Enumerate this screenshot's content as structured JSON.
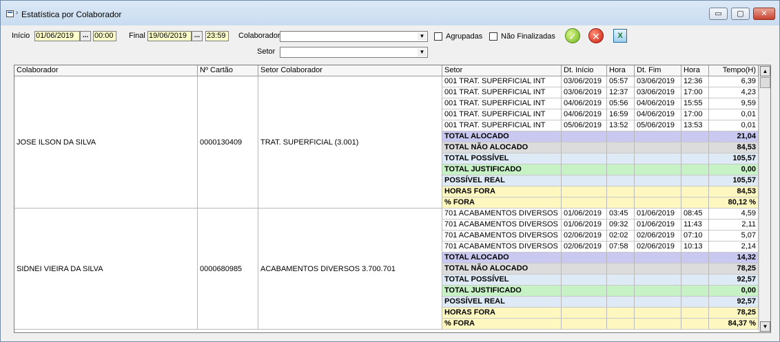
{
  "window": {
    "title": "Estatística por Colaborador",
    "controls": {
      "minimize": "▭",
      "maximize": "▢",
      "close": "✕"
    }
  },
  "filters": {
    "inicio_label": "Início",
    "inicio_date": "01/06/2019",
    "inicio_time": "00:00",
    "final_label": "Final",
    "final_date": "19/06/2019",
    "final_time": "23:59",
    "picker_glyph": "...",
    "colaborador_label": "Colaborador",
    "colaborador_value": "",
    "setor_label": "Setor",
    "setor_value": "",
    "agrupadas_label": "Agrupadas",
    "agrupadas_checked": false,
    "nao_finalizadas_label": "Não Finalizadas",
    "nao_finalizadas_checked": false,
    "dropdown_glyph": "▼",
    "ok_glyph": "✓",
    "cancel_glyph": "✕",
    "excel_glyph": "X"
  },
  "colors": {
    "alocado": "#c8c8f0",
    "nao_alocado": "#dcdcdc",
    "possivel": "#deebf7",
    "justificado": "#c6f2c6",
    "possivel_real": "#deebf7",
    "horas_fora": "#fff7c0",
    "pct_fora": "#fff7c0"
  },
  "grid": {
    "headers": [
      "Colaborador",
      "Nº Cartão",
      "Setor Colaborador",
      "Setor",
      "Dt. Início",
      "Hora",
      "Dt. Fim",
      "Hora",
      "Tempo(H)"
    ],
    "groups": [
      {
        "colaborador": "JOSE ILSON DA SILVA",
        "cartao": "0000130409",
        "setor_colaborador": "TRAT. SUPERFICIAL (3.001)",
        "rows": [
          [
            "001 TRAT. SUPERFICIAL INT",
            "03/06/2019",
            "05:57",
            "03/06/2019",
            "12:36",
            "6,39"
          ],
          [
            "001 TRAT. SUPERFICIAL INT",
            "03/06/2019",
            "12:37",
            "03/06/2019",
            "17:00",
            "4,23"
          ],
          [
            "001 TRAT. SUPERFICIAL INT",
            "04/06/2019",
            "05:56",
            "04/06/2019",
            "15:55",
            "9,59"
          ],
          [
            "001 TRAT. SUPERFICIAL INT",
            "04/06/2019",
            "16:59",
            "04/06/2019",
            "17:00",
            "0,01"
          ],
          [
            "001 TRAT. SUPERFICIAL INT",
            "05/06/2019",
            "13:52",
            "05/06/2019",
            "13:53",
            "0,01"
          ]
        ],
        "totals": [
          {
            "label": "TOTAL ALOCADO",
            "value": "21,04",
            "kind": "alocado"
          },
          {
            "label": "TOTAL NÃO ALOCADO",
            "value": "84,53",
            "kind": "nao_alocado"
          },
          {
            "label": "TOTAL POSSÍVEL",
            "value": "105,57",
            "kind": "possivel"
          },
          {
            "label": "TOTAL JUSTIFICADO",
            "value": "0,00",
            "kind": "justificado"
          },
          {
            "label": "POSSÍVEL REAL",
            "value": "105,57",
            "kind": "possivel_real"
          },
          {
            "label": "HORAS FORA",
            "value": "84,53",
            "kind": "horas_fora"
          },
          {
            "label": "% FORA",
            "value": "80,12 %",
            "kind": "pct_fora"
          }
        ]
      },
      {
        "colaborador": "SIDNEI VIEIRA DA SILVA",
        "cartao": "0000680985",
        "setor_colaborador": "ACABAMENTOS DIVERSOS 3.700.701",
        "rows": [
          [
            "701 ACABAMENTOS DIVERSOS",
            "01/06/2019",
            "03:45",
            "01/06/2019",
            "08:45",
            "4,59"
          ],
          [
            "701 ACABAMENTOS DIVERSOS",
            "01/06/2019",
            "09:32",
            "01/06/2019",
            "11:43",
            "2,11"
          ],
          [
            "701 ACABAMENTOS DIVERSOS",
            "02/06/2019",
            "02:02",
            "02/06/2019",
            "07:10",
            "5,07"
          ],
          [
            "701 ACABAMENTOS DIVERSOS",
            "02/06/2019",
            "07:58",
            "02/06/2019",
            "10:13",
            "2,14"
          ]
        ],
        "totals": [
          {
            "label": "TOTAL ALOCADO",
            "value": "14,32",
            "kind": "alocado"
          },
          {
            "label": "TOTAL NÃO ALOCADO",
            "value": "78,25",
            "kind": "nao_alocado"
          },
          {
            "label": "TOTAL POSSÍVEL",
            "value": "92,57",
            "kind": "possivel"
          },
          {
            "label": "TOTAL JUSTIFICADO",
            "value": "0,00",
            "kind": "justificado"
          },
          {
            "label": "POSSÍVEL REAL",
            "value": "92,57",
            "kind": "possivel_real"
          },
          {
            "label": "HORAS FORA",
            "value": "78,25",
            "kind": "horas_fora"
          },
          {
            "label": "% FORA",
            "value": "84,37 %",
            "kind": "pct_fora"
          }
        ]
      }
    ],
    "scroll": {
      "up": "▲",
      "down": "▼"
    }
  }
}
